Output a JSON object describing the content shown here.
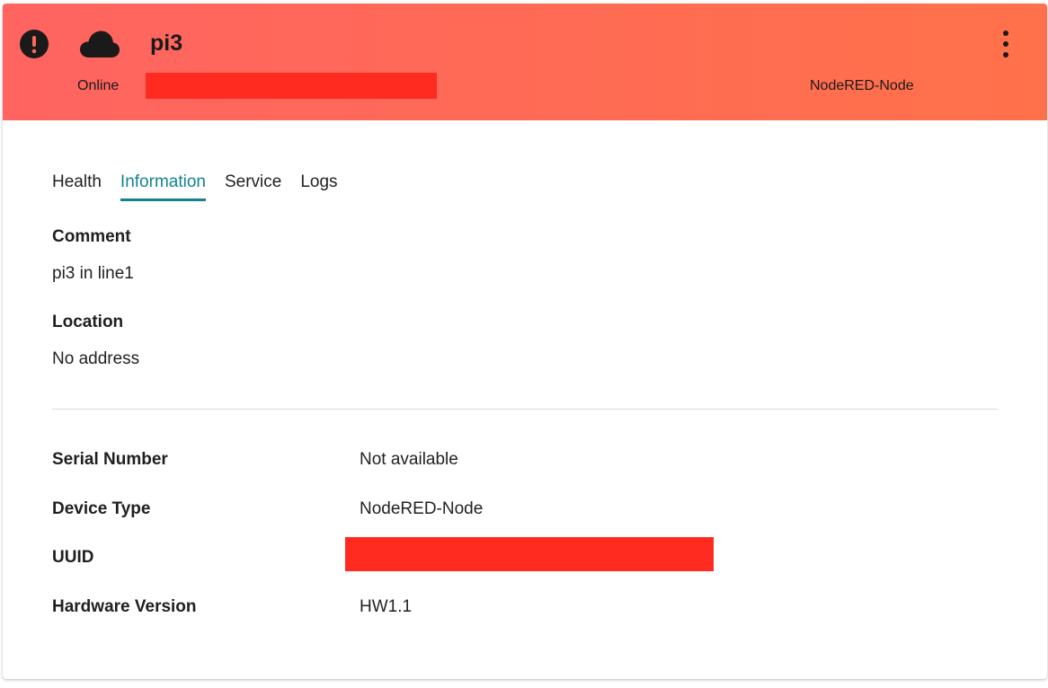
{
  "header": {
    "title": "pi3",
    "status": "Online",
    "device_type": "NodeRED-Node",
    "gradient_start": "#ff6461",
    "gradient_end": "#ff714a",
    "redaction_color": "#ff2b20",
    "icons": {
      "alert": "alert-circle-icon",
      "cloud": "cloud-icon",
      "menu": "kebab-menu-icon"
    }
  },
  "tabs": [
    {
      "label": "Health",
      "active": false
    },
    {
      "label": "Information",
      "active": true
    },
    {
      "label": "Service",
      "active": false
    },
    {
      "label": "Logs",
      "active": false
    }
  ],
  "accent_color": "#13828d",
  "info": {
    "comment_label": "Comment",
    "comment_value": "pi3 in line1",
    "location_label": "Location",
    "location_value": "No address"
  },
  "details": [
    {
      "label": "Serial Number",
      "value": "Not available"
    },
    {
      "label": "Device Type",
      "value": "NodeRED-Node"
    },
    {
      "label": "UUID",
      "value": ""
    },
    {
      "label": "Hardware Version",
      "value": "HW1.1"
    }
  ]
}
